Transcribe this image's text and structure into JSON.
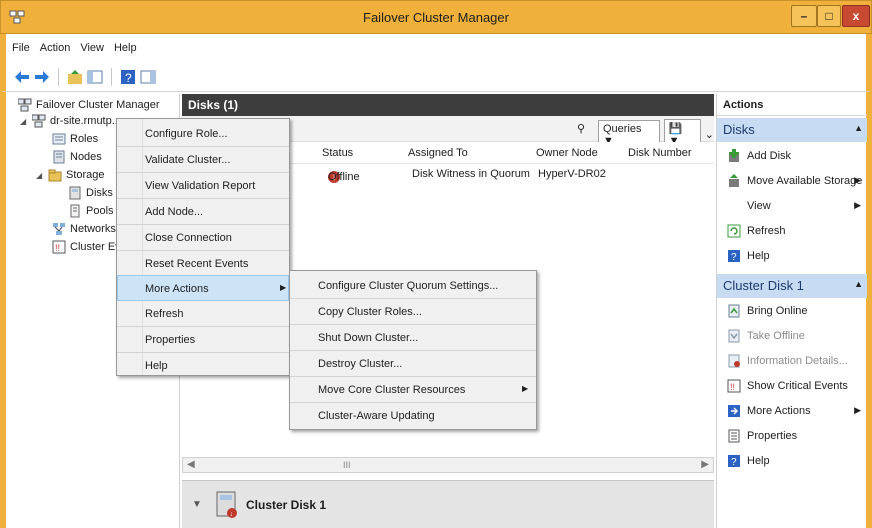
{
  "window": {
    "title": "Failover Cluster Manager"
  },
  "menu": [
    "File",
    "Action",
    "View",
    "Help"
  ],
  "tree": {
    "root": "Failover Cluster Manager",
    "cluster": "dr-site.rmutp...",
    "roles": "Roles",
    "nodes": "Nodes",
    "storage": "Storage",
    "disks": "Disks",
    "pools": "Pools",
    "networks": "Networks",
    "cluster_events": "Cluster Ev"
  },
  "center": {
    "title": "Disks (1)",
    "queries_label": "Queries",
    "columns": [
      "Status",
      "Assigned To",
      "Owner Node",
      "Disk Number"
    ],
    "rows": [
      {
        "status": "Offline",
        "assigned_to": "Disk Witness in Quorum",
        "owner_node": "HyperV-DR02",
        "disk_number": ""
      }
    ],
    "scroll_thumb": "III",
    "detail_label": "Cluster Disk 1"
  },
  "actions": {
    "header": "Actions",
    "section_disks": "Disks",
    "disks_items": [
      "Add Disk",
      "Move Available Storage",
      "View",
      "Refresh",
      "Help"
    ],
    "section_disk1": "Cluster Disk 1",
    "disk1_items": [
      "Bring Online",
      "Take Offline",
      "Information Details...",
      "Show Critical Events",
      "More Actions",
      "Properties",
      "Help"
    ]
  },
  "context_menu": {
    "items": [
      "Configure Role...",
      "Validate Cluster...",
      "View Validation Report",
      "Add Node...",
      "Close Connection",
      "Reset Recent Events",
      "More Actions",
      "Refresh",
      "Properties",
      "Help"
    ]
  },
  "submenu": {
    "items": [
      "Configure Cluster Quorum Settings...",
      "Copy Cluster Roles...",
      "Shut Down Cluster...",
      "Destroy Cluster...",
      "Move Core Cluster Resources",
      "Cluster-Aware Updating"
    ]
  },
  "colors": {
    "chrome": "#f0b13c",
    "section": "#c7dcf2",
    "header_dark": "#3d3d3d",
    "highlight": "#cde4f7"
  }
}
